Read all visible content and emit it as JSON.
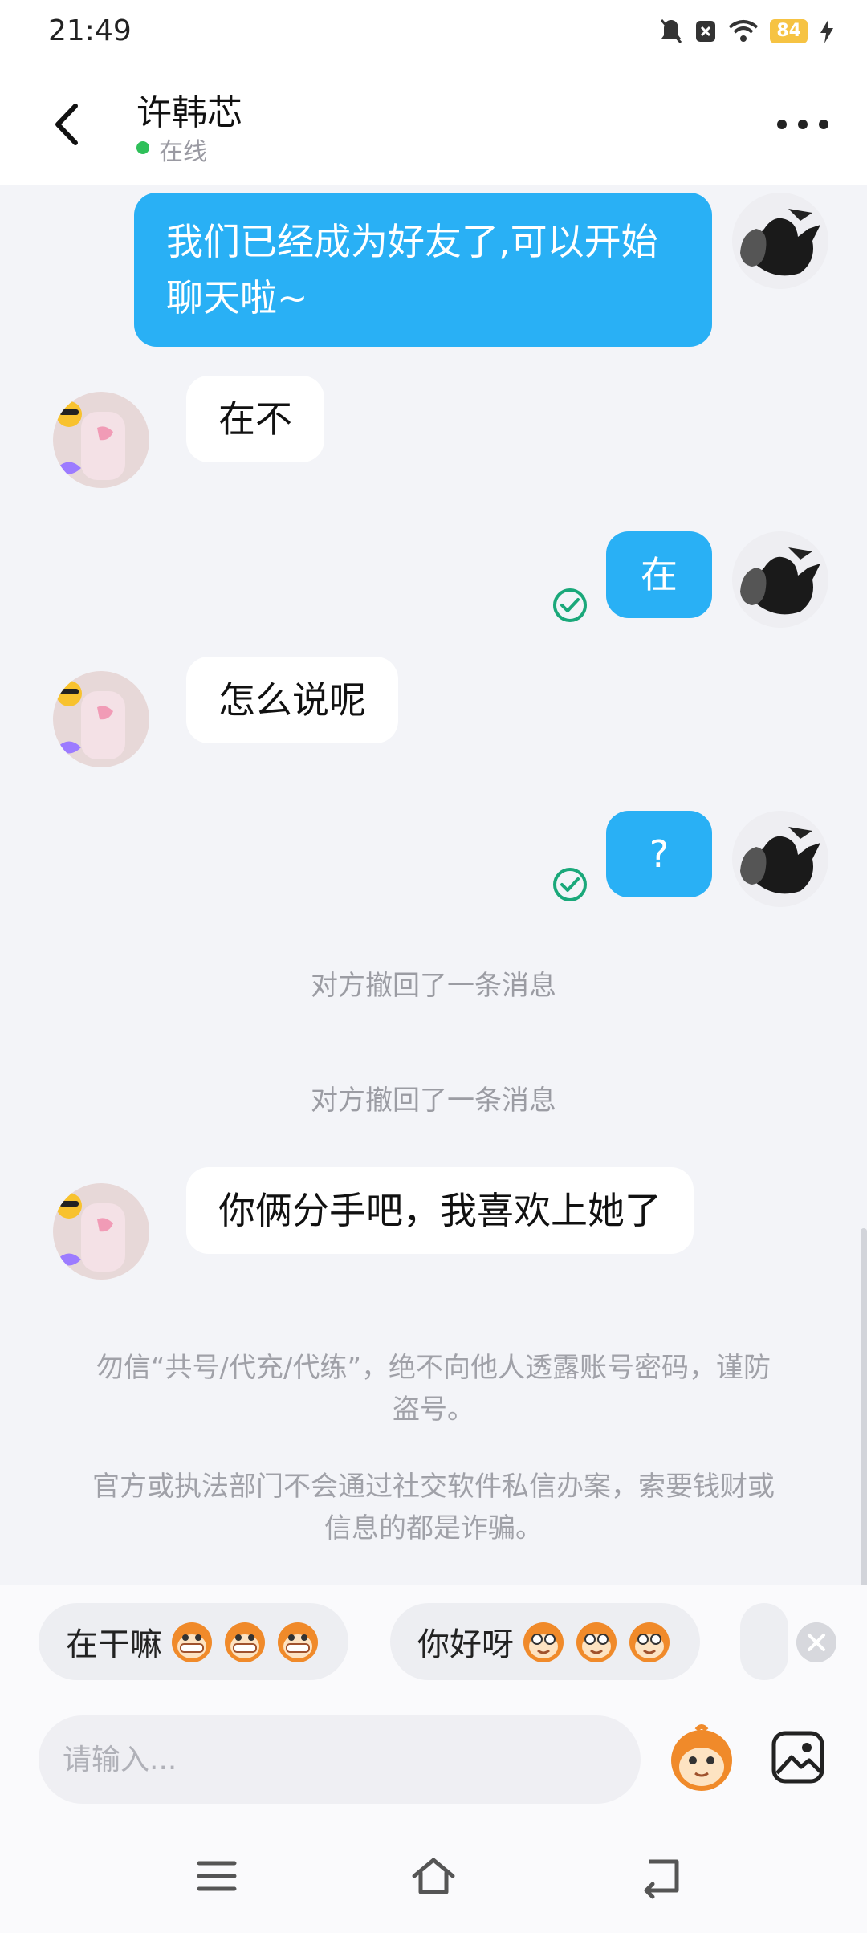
{
  "status_bar": {
    "time": "21:49",
    "battery": "84"
  },
  "header": {
    "contact_name": "许韩芯",
    "status": "在线"
  },
  "messages": [
    {
      "side": "me",
      "text_lines": [
        "我们已经成为好友了,可以开始",
        "聊天啦~"
      ]
    },
    {
      "side": "other",
      "text": "在不"
    },
    {
      "side": "me",
      "text": "在",
      "read": true
    },
    {
      "side": "other",
      "text": "怎么说呢"
    },
    {
      "side": "me",
      "text": "?",
      "read": true
    },
    {
      "side": "system",
      "text": "对方撤回了一条消息"
    },
    {
      "side": "system",
      "text": "对方撤回了一条消息"
    },
    {
      "side": "other",
      "text": "你俩分手吧，我喜欢上她了"
    }
  ],
  "notices": [
    {
      "lines": [
        "勿信“共号/代充/代练”，绝不向他人透露账号密码，谨防",
        "盗号。"
      ]
    },
    {
      "lines": [
        "官方或执法部门不会通过社交软件私信办案，索要钱财或",
        "信息的都是诈骗。"
      ]
    }
  ],
  "quick_replies": [
    {
      "label": "在干嘛"
    },
    {
      "label": "你好呀"
    }
  ],
  "input": {
    "placeholder": "请输入..."
  },
  "colors": {
    "my_bubble": "#29b0f5",
    "online_dot": "#2fc05a",
    "read_check": "#1aa87a"
  }
}
